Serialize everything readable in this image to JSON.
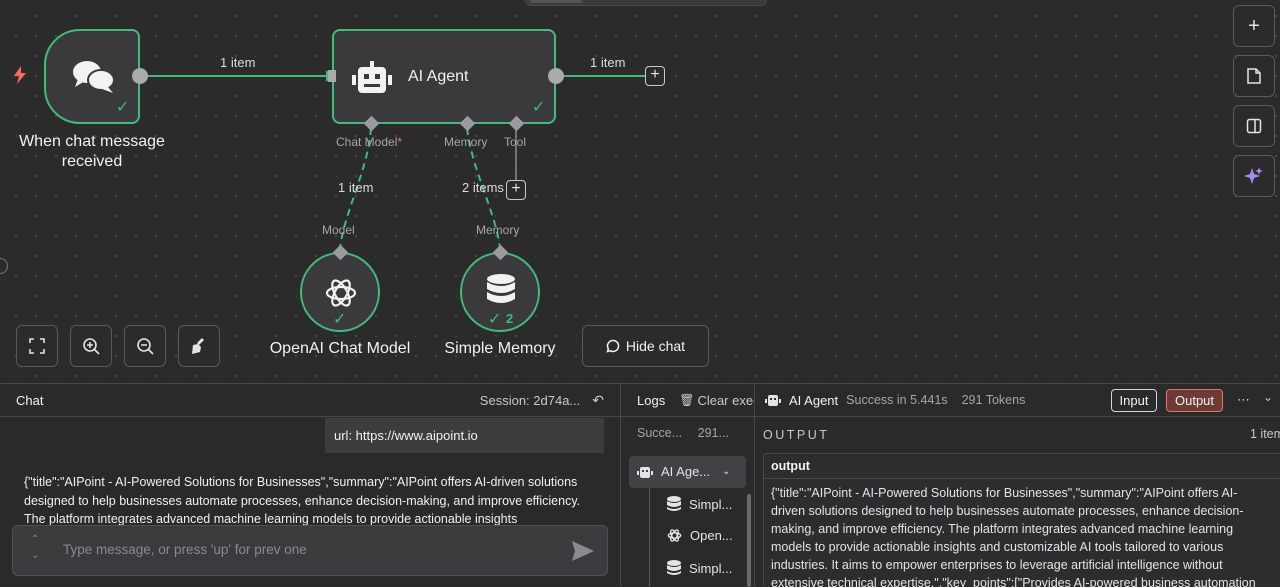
{
  "canvas": {
    "edges": {
      "trigger_to_agent": "1 item",
      "agent_out": "1 item",
      "model_edge": "1 item",
      "memory_edge": "2 items"
    },
    "nodes": {
      "trigger": {
        "label": "When chat message received"
      },
      "agent": {
        "label": "AI Agent",
        "ports": {
          "chat_model": "Chat Model",
          "required_mark": "*",
          "memory": "Memory",
          "tool": "Tool"
        }
      },
      "openai": {
        "label": "OpenAI Chat Model",
        "port_label": "Model"
      },
      "memory": {
        "label": "Simple Memory",
        "port_label": "Memory",
        "run_count": "2"
      }
    },
    "hide_chat_label": "Hide chat",
    "accent_success": "#3fbb7a",
    "accent_trigger": "#ff6d5a"
  },
  "chat": {
    "title": "Chat",
    "session": "Session: 2d74a...",
    "user_message": "url: https://www.aipoint.io",
    "bot_message": "{\"title\":\"AIPoint - AI-Powered Solutions for Businesses\",\"summary\":\"AIPoint offers AI-driven solutions designed to help businesses automate processes, enhance decision-making, and improve efficiency. The platform integrates advanced machine learning models to provide actionable insights",
    "input_placeholder": "Type message, or press 'up' for prev one"
  },
  "logs": {
    "title": "Logs",
    "clear_label": "Clear exec",
    "summary_status": "Succe...",
    "summary_tokens": "291...",
    "items": [
      {
        "label": "AI Age...",
        "icon": "robot-icon"
      },
      {
        "label": "Simpl...",
        "icon": "database-icon"
      },
      {
        "label": "Open...",
        "icon": "openai-icon"
      },
      {
        "label": "Simpl...",
        "icon": "database-icon"
      }
    ]
  },
  "output_panel": {
    "node_name": "AI Agent",
    "status": "Success in 5.441s",
    "tokens": "291 Tokens",
    "input_tab": "Input",
    "output_tab": "Output",
    "section_title": "OUTPUT",
    "items_count": "1 item",
    "field_name": "output",
    "field_value": "{\"title\":\"AIPoint - AI-Powered Solutions for Businesses\",\"summary\":\"AIPoint offers AI-driven solutions designed to help businesses automate processes, enhance decision-making, and improve efficiency. The platform integrates advanced machine learning models to provide actionable insights and customizable AI tools tailored to various industries. It aims to empower enterprises to leverage artificial intelligence without extensive technical expertise.\",\"key_points\":[\"Provides AI-powered business automation"
  }
}
